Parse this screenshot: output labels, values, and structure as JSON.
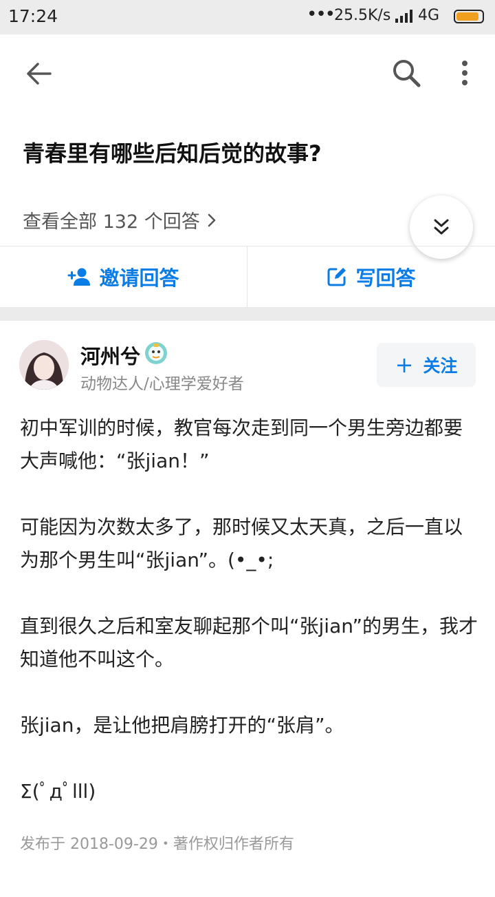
{
  "status_bar": {
    "time": "17:24",
    "dots": "•••",
    "speed": "25.5K/s",
    "network": "4G",
    "battery_level": 0.9
  },
  "toolbar": {
    "back_icon": "arrow-left-icon",
    "search_icon": "search-icon",
    "more_icon": "more-vertical-icon"
  },
  "question": {
    "title": "青春里有哪些后知后觉的故事?",
    "view_all": "查看全部 132 个回答"
  },
  "actions": {
    "invite_label": "邀请回答",
    "write_label": "写回答"
  },
  "answer": {
    "author_name": "河州兮",
    "author_bio": "动物达人/心理学爱好者",
    "follow_label": "关注",
    "paragraphs": [
      "初中军训的时候，教官每次走到同一个男生旁边都要大声喊他：“张jian！”",
      "可能因为次数太多了，那时候又太天真，之后一直以为那个男生叫“张jian”。(•_•;",
      "直到很久之后和室友聊起那个叫“张jian”的男生，我才知道他不叫这个。",
      "张jian，是让他把肩膀打开的“张肩”。",
      "Σ(ﾟдﾟlll)"
    ],
    "meta": "发布于 2018-09-29・著作权归作者所有"
  },
  "colors": {
    "accent": "#0a7ce6",
    "status_bar_bg": "#ececec",
    "divider_band": "#ebebeb"
  }
}
